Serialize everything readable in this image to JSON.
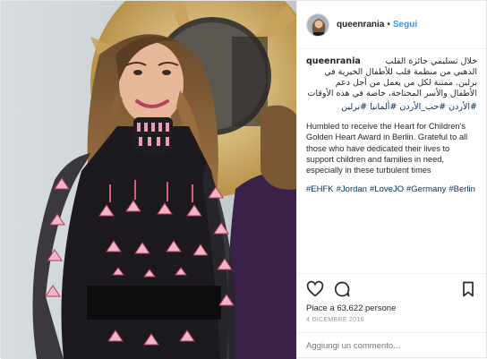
{
  "header": {
    "username": "queenrania",
    "separator": "•",
    "follow_label": "Segui"
  },
  "caption": {
    "username": "queenrania",
    "arabic_text": "خلال تسليمي جائزة القلب الذهبي من منظمة قلب للأطفال الخيرية في برلين. ممتنة لكل من يعمل من أجل دعم الأطفال والأسر المحتاجة، خاصة في هذه الأوقات",
    "arabic_hashtags": "#الأردن #حب_الأردن #ألمانيا #برلين",
    "english_text": "Humbled to receive the Heart for Children's Golden Heart Award in Berlin. Grateful to all those who have dedicated their lives to support children and families in need, especially in these turbulent times",
    "hashtags": [
      "#EHFK",
      "#Jordan",
      "#LoveJO",
      "#Germany",
      "#Berlin"
    ]
  },
  "actions": {
    "like_icon": "heart-icon",
    "comment_icon": "comment-icon",
    "save_icon": "bookmark-icon"
  },
  "likes_text": "Piace a 63.622 persone",
  "date_text": "4 DICEMBRE 2016",
  "comment_input": {
    "placeholder": "Aggiungi un commento..."
  },
  "colors": {
    "link_blue": "#3897f0",
    "hashtag": "#003569",
    "text": "#262626",
    "muted": "#999999"
  }
}
